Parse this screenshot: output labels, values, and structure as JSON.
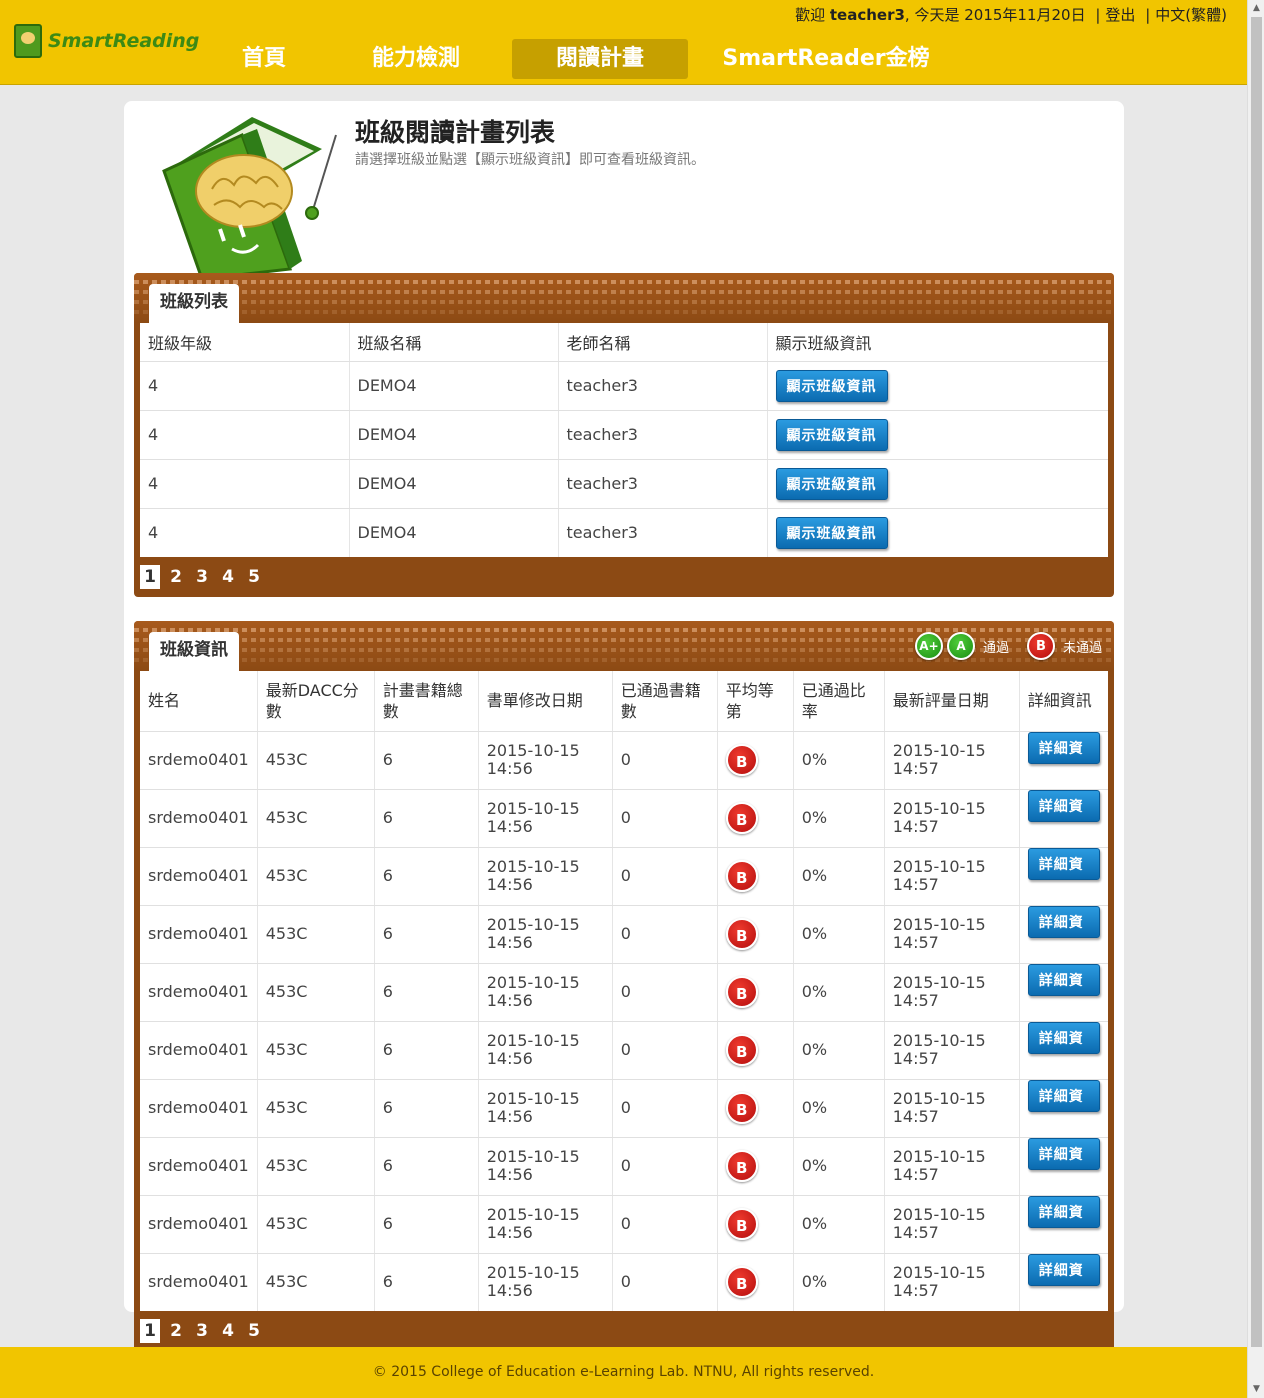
{
  "brand": {
    "logo_text": "SmartReading"
  },
  "user_bar": {
    "welcome_prefix": "歡迎",
    "username": "teacher3",
    "date_text": ", 今天是 2015年11月20日",
    "logout": "登出",
    "language": "中文(繁體)"
  },
  "nav": [
    {
      "label": "首頁",
      "active": false
    },
    {
      "label": "能力檢測",
      "active": false
    },
    {
      "label": "閱讀計畫",
      "active": true
    },
    {
      "label": "SmartReader金榜",
      "active": false
    }
  ],
  "page": {
    "title": "班級閱讀計畫列表",
    "subtitle": "請選擇班級並點選【顯示班級資訊】即可查看班級資訊。"
  },
  "class_list": {
    "tab_label": "班級列表",
    "headers": [
      "班級年級",
      "班級名稱",
      "老師名稱",
      "顯示班級資訊"
    ],
    "button_label": "顯示班級資訊",
    "rows": [
      {
        "grade": "4",
        "name": "DEMO4",
        "teacher": "teacher3"
      },
      {
        "grade": "4",
        "name": "DEMO4",
        "teacher": "teacher3"
      },
      {
        "grade": "4",
        "name": "DEMO4",
        "teacher": "teacher3"
      },
      {
        "grade": "4",
        "name": "DEMO4",
        "teacher": "teacher3"
      }
    ],
    "pages": [
      "1",
      "2",
      "3",
      "4",
      "5"
    ],
    "current_page": "1"
  },
  "class_info": {
    "tab_label": "班級資訊",
    "legend": {
      "pass_grades": [
        "A+",
        "A"
      ],
      "pass_label": "通過",
      "fail_grade": "B",
      "fail_label": "未通過"
    },
    "headers": [
      "姓名",
      "最新DACC分數",
      "計畫書籍總數",
      "書單修改日期",
      "已通過書籍數",
      "平均等第",
      "已通過比率",
      "最新評量日期",
      "詳細資訊"
    ],
    "button_label": "詳細資訊",
    "rows": [
      {
        "name": "srdemo0401",
        "dacc": "453C",
        "total": "6",
        "modified": "2015-10-15 14:56",
        "passed": "0",
        "grade": "B",
        "rate": "0%",
        "eval_date": "2015-10-15 14:57"
      },
      {
        "name": "srdemo0401",
        "dacc": "453C",
        "total": "6",
        "modified": "2015-10-15 14:56",
        "passed": "0",
        "grade": "B",
        "rate": "0%",
        "eval_date": "2015-10-15 14:57"
      },
      {
        "name": "srdemo0401",
        "dacc": "453C",
        "total": "6",
        "modified": "2015-10-15 14:56",
        "passed": "0",
        "grade": "B",
        "rate": "0%",
        "eval_date": "2015-10-15 14:57"
      },
      {
        "name": "srdemo0401",
        "dacc": "453C",
        "total": "6",
        "modified": "2015-10-15 14:56",
        "passed": "0",
        "grade": "B",
        "rate": "0%",
        "eval_date": "2015-10-15 14:57"
      },
      {
        "name": "srdemo0401",
        "dacc": "453C",
        "total": "6",
        "modified": "2015-10-15 14:56",
        "passed": "0",
        "grade": "B",
        "rate": "0%",
        "eval_date": "2015-10-15 14:57"
      },
      {
        "name": "srdemo0401",
        "dacc": "453C",
        "total": "6",
        "modified": "2015-10-15 14:56",
        "passed": "0",
        "grade": "B",
        "rate": "0%",
        "eval_date": "2015-10-15 14:57"
      },
      {
        "name": "srdemo0401",
        "dacc": "453C",
        "total": "6",
        "modified": "2015-10-15 14:56",
        "passed": "0",
        "grade": "B",
        "rate": "0%",
        "eval_date": "2015-10-15 14:57"
      },
      {
        "name": "srdemo0401",
        "dacc": "453C",
        "total": "6",
        "modified": "2015-10-15 14:56",
        "passed": "0",
        "grade": "B",
        "rate": "0%",
        "eval_date": "2015-10-15 14:57"
      },
      {
        "name": "srdemo0401",
        "dacc": "453C",
        "total": "6",
        "modified": "2015-10-15 14:56",
        "passed": "0",
        "grade": "B",
        "rate": "0%",
        "eval_date": "2015-10-15 14:57"
      },
      {
        "name": "srdemo0401",
        "dacc": "453C",
        "total": "6",
        "modified": "2015-10-15 14:56",
        "passed": "0",
        "grade": "B",
        "rate": "0%",
        "eval_date": "2015-10-15 14:57"
      }
    ],
    "pages": [
      "1",
      "2",
      "3",
      "4",
      "5"
    ],
    "current_page": "1"
  },
  "footer": {
    "copyright": "© 2015 College of Education e-Learning Lab. NTNU, All rights reserved."
  },
  "colors": {
    "header_bg": "#f1c500",
    "panel_brown": "#8c4a14",
    "button_blue": "#0b6bb0",
    "fail_red": "#c41010",
    "pass_green": "#1b8e12"
  }
}
